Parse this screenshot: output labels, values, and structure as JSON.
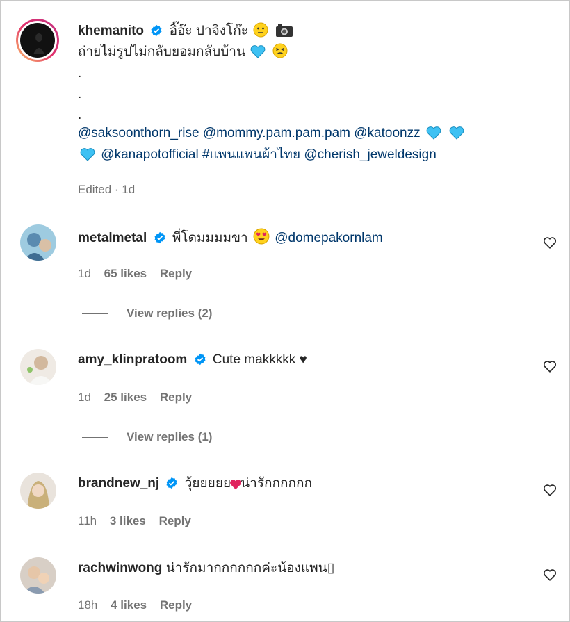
{
  "caption": {
    "username": "khemanito",
    "line1_text": "อิ๊อ๊ะ ปาจิงโก๊ะ",
    "line2_text": "ถ่ายไม่รูปไม่กลับยอมกลับบ้าน",
    "dots": [
      ".",
      ".",
      "."
    ],
    "mentions_line1": [
      "@saksoonthorn_rise",
      "@mommy.pam.pam.pam",
      "@katoonzz"
    ],
    "mentions_line2": [
      "@kanapotofficial",
      "#แพนแพนผ้าไทย",
      "@cherish_jeweldesign"
    ],
    "meta": "Edited · 1d"
  },
  "comments": [
    {
      "username": "metalmetal",
      "text": "พี่โดมมมมขา",
      "mention": "@domepakornlam",
      "time": "1d",
      "likes": "65 likes",
      "reply": "Reply",
      "view_replies": "View replies (2)"
    },
    {
      "username": "amy_klinpratoom",
      "text": "Cute makkkkk ♥",
      "time": "1d",
      "likes": "25 likes",
      "reply": "Reply",
      "view_replies": "View replies (1)"
    },
    {
      "username": "brandnew_nj",
      "text": "วุ้ยยยยย",
      "text_after": "น่ารักกกกกก",
      "time": "11h",
      "likes": "3 likes",
      "reply": "Reply"
    },
    {
      "username": "rachwinwong",
      "text": "น่ารักมากกกกกกค่ะน้องแพน",
      "text_suffix": "▯",
      "time": "18h",
      "likes": "4 likes",
      "reply": "Reply"
    }
  ],
  "colors": {
    "text": "#262626",
    "secondary": "#737373",
    "link": "#00376b",
    "verified": "#0095f6"
  }
}
